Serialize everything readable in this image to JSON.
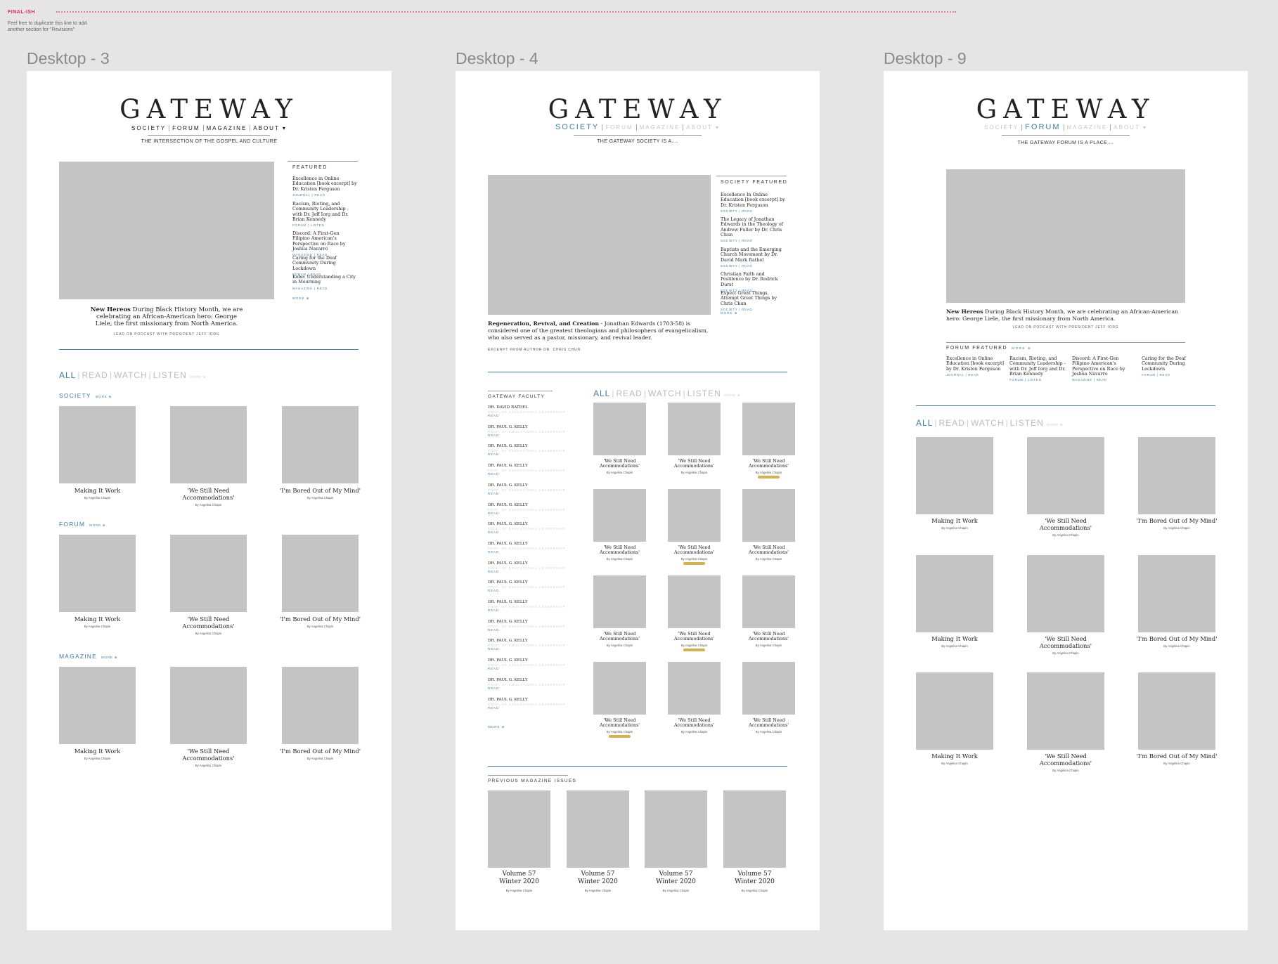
{
  "stage": {
    "label": "FINAL-ISH",
    "note": "Feel free to duplicate this line to add another section for \"Revisions\""
  },
  "brand": {
    "logo": "GATEWAY"
  },
  "frames": {
    "d3": {
      "title": "Desktop - 3",
      "nav": [
        "SOCIETY",
        "FORUM",
        "MAGAZINE",
        "ABOUT ▾"
      ],
      "tagline": "THE INTERSECTION OF THE GOSPEL AND CULTURE",
      "hero_caption_bold": "New Hereos",
      "hero_caption": " During Black History Month, we are celebrating an African-American hero: George Liele, the first missionary from North America.",
      "hero_meta": "LEAD ON PODCAST WITH PRESIDENT JEFF IORG",
      "featured_title": "FEATURED",
      "featured": [
        {
          "title": "Excellence in Online Education [book excerpt] by Dr. Kristen Ferguson",
          "meta": "JOURNAL | READ"
        },
        {
          "title": "Racism, Rioting, and Community Leadership - with Dr. Jeff Iorg and Dr. Brian Kennedy",
          "meta": "FORUM | LISTEN"
        },
        {
          "title": "Discord: A First-Gen Filipino American's Perspective on Race by Joshua Navarro",
          "meta": "MAGAZINE | READ"
        },
        {
          "title": "Caring for the Deaf Community During Lockdown",
          "meta": "FORUM | READ"
        },
        {
          "title": "Kobe: Understanding a City in Mourning",
          "meta": "MAGAZINE | READ"
        }
      ],
      "more": "MORE ⊕",
      "filters": [
        "ALL",
        "READ",
        "WATCH",
        "LISTEN"
      ],
      "filter_more": "MORE ⊕",
      "sections": [
        {
          "label": "SOCIETY",
          "more": "MORE ⊕"
        },
        {
          "label": "FORUM",
          "more": "MORE ⊕"
        },
        {
          "label": "MAGAZINE",
          "more": "MORE ⊕"
        }
      ],
      "cards": [
        {
          "title": "Making It Work",
          "by": "By Angelina Chapin"
        },
        {
          "title": "'We Still Need Accommodations'",
          "by": "By Angelina Chapin"
        },
        {
          "title": "'I'm Bored Out of My Mind'",
          "by": "By Angelina Chapin"
        }
      ]
    },
    "d4": {
      "title": "Desktop - 4",
      "nav": [
        "SOCIETY",
        "FORUM",
        "MAGAZINE",
        "ABOUT ▾"
      ],
      "tagline": "THE GATEWAY SOCIETY IS A....",
      "hero_caption_bold": "Regeneration, Revival, and Creation",
      "hero_caption": " - Jonathan Edwards (1703-58) is considered one of the greatest theologians and philosophers of evangelicalism, who also served as a pastor, missionary, and revival leader.",
      "hero_meta": "EXCERPT FROM AUTHOR DR. CHRIS CHUN",
      "featured_title": "SOCIETY FEATURED",
      "featured": [
        {
          "title": "Excellence In Online Education [book excerpt] by Dr. Kristen Ferguson",
          "meta": "SOCIETY | READ"
        },
        {
          "title": "The Legacy of Jonathan Edwards in the Theology of Andrew Fuller by Dr. Chris Chun",
          "meta": "SOCIETY | READ"
        },
        {
          "title": "Baptists and the Emerging Church Movement by Dr. David Mark Rathel",
          "meta": "SOCIETY | READ"
        },
        {
          "title": "Christian Faith and Pestilence by Dr. Rodrick Durst",
          "meta": "SOCIETY | READ"
        },
        {
          "title": "Expect Great Things, Attempt Great Things by Chris Chun",
          "meta": "SOCIETY | READ"
        }
      ],
      "more": "MORE ⊕",
      "faculty_title": "GATEWAY FACULTY",
      "faculty_role": "PROF. OF EDUCATIONAL LEADERSHIP",
      "faculty_link": "READ",
      "faculty": [
        "DR. DAVID RATHEL",
        "DR. PAUL G. KELLY",
        "DR. PAUL G. KELLY",
        "DR. PAUL G. KELLY",
        "DR. PAUL G. KELLY",
        "DR. PAUL G. KELLY",
        "DR. PAUL G. KELLY",
        "DR. PAUL G. KELLY",
        "DR. PAUL G. KELLY",
        "DR. PAUL G. KELLY",
        "DR. PAUL G. KELLY",
        "DR. PAUL G. KELLY",
        "DR. PAUL G. KELLY",
        "DR. PAUL G. KELLY",
        "DR. PAUL G. KELLY",
        "DR. PAUL G. KELLY"
      ],
      "filters": [
        "ALL",
        "READ",
        "WATCH",
        "LISTEN"
      ],
      "filter_more": "MORE ⊕",
      "grid_title": "'We Still Need Accommodations'",
      "grid_by": "By Angelina Chapin",
      "issues_title": "PREVIOUS MAGAZINE ISSUES",
      "issue_title_1": "Volume 57",
      "issue_title_2": "Winter 2020",
      "issue_by": "By Angelina Chapin"
    },
    "d9": {
      "title": "Desktop - 9",
      "nav": [
        "SOCIETY",
        "FORUM",
        "MAGAZINE",
        "ABOUT ▾"
      ],
      "tagline": "THE GATEWAY FORUM IS A PLACE....",
      "hero_caption_bold": "New Hereos",
      "hero_caption": " During Black History Month, we are celebrating an African-American hero: George Liele, the first missionary from North America.",
      "hero_meta": "LEAD ON PODCAST WITH PRESIDENT JEFF IORG",
      "featured_title": "FORUM FEATURED",
      "featured_more": "MORE ⊕",
      "featured": [
        {
          "title": "Excellence in Online Education [book excerpt] by Dr. Kristen Ferguson",
          "meta": "JOURNAL | READ"
        },
        {
          "title": "Racism, Rioting, and Community Leadership - with Dr. Jeff Iorg and Dr. Brian Kennedy",
          "meta": "FORUM | LISTEN"
        },
        {
          "title": "Discord: A First-Gen Filipino American's Perspective on Race by Joshua Navarro",
          "meta": "MAGAZINE | READ"
        },
        {
          "title": "Caring for the Deaf Community During Lockdown",
          "meta": "FORUM | READ"
        }
      ],
      "filters": [
        "ALL",
        "READ",
        "WATCH",
        "LISTEN"
      ],
      "filter_more": "MORE ⊕",
      "cards": [
        {
          "title": "Making It Work",
          "by": "By Angelina Chapin"
        },
        {
          "title": "'We Still Need Accommodations'",
          "by": "By Angelina Chapin"
        },
        {
          "title": "'I'm Bored Out of My Mind'",
          "by": "By Angelina Chapin"
        }
      ]
    }
  }
}
